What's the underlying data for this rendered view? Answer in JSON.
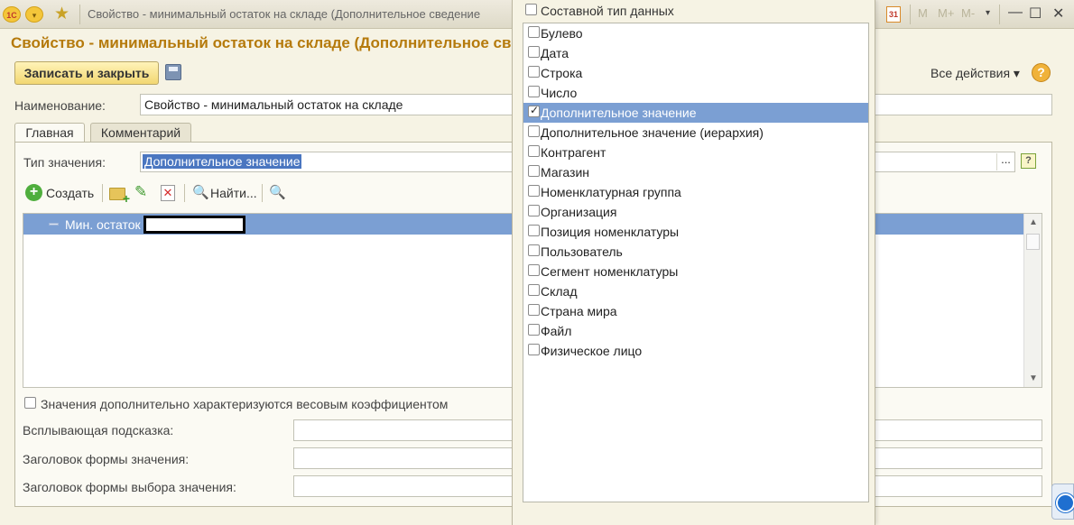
{
  "window": {
    "title": "Свойство - минимальный остаток на складе (Дополнительное сведение",
    "logo_text": "1С",
    "down_glyph": "▾",
    "star_glyph": "★",
    "calendar_text": "31",
    "memory_buttons": [
      "M",
      "M+",
      "M-"
    ],
    "minimize_glyph": "—",
    "maximize_glyph": "☐",
    "close_glyph": "✕"
  },
  "form": {
    "title": "Свойство - минимальный остаток на складе (Дополнительное све",
    "save_close_label": "Записать и закрыть",
    "all_actions_label": "Все действия ▾",
    "help_glyph": "?",
    "name_label": "Наименование:",
    "name_value": "Свойство - минимальный остаток на складе"
  },
  "tabs": [
    {
      "label": "Главная",
      "active": true
    },
    {
      "label": "Комментарий",
      "active": false
    }
  ],
  "main_tab": {
    "value_type_label": "Тип значения:",
    "value_type_value": "Дополнительное значение",
    "select_button_label": "...",
    "hint_glyph": "?",
    "toolbar": {
      "create_glyph": "+",
      "create_label": "Создать",
      "pencil_glyph": "✎",
      "delete_glyph": "✕",
      "find_glyph": "🔍",
      "find_label": "Найти...",
      "find_extra_glyph": "🔍"
    },
    "values_list": [
      {
        "name": "Мин. остаток",
        "selected": true
      }
    ],
    "scroll_up_glyph": "▲",
    "scroll_down_glyph": "▼",
    "weight_checkbox_label": "Значения дополнительно характеризуются весовым коэффициентом",
    "weight_checked": false,
    "tooltip_label": "Всплывающая подсказка:",
    "value_form_title_label": "Заголовок формы значения:",
    "choice_form_title_label": "Заголовок формы выбора значения:"
  },
  "type_popup": {
    "composite_label": "Составной тип данных",
    "composite_checked": false,
    "items": [
      {
        "label": "Булево",
        "checked": false,
        "selected": false
      },
      {
        "label": "Дата",
        "checked": false,
        "selected": false
      },
      {
        "label": "Строка",
        "checked": false,
        "selected": false
      },
      {
        "label": "Число",
        "checked": false,
        "selected": false
      },
      {
        "label": "Дополнительное значение",
        "checked": true,
        "selected": true
      },
      {
        "label": "Дополнительное значение (иерархия)",
        "checked": false,
        "selected": false
      },
      {
        "label": "Контрагент",
        "checked": false,
        "selected": false
      },
      {
        "label": "Магазин",
        "checked": false,
        "selected": false
      },
      {
        "label": "Номенклатурная группа",
        "checked": false,
        "selected": false
      },
      {
        "label": "Организация",
        "checked": false,
        "selected": false
      },
      {
        "label": "Позиция номенклатуры",
        "checked": false,
        "selected": false
      },
      {
        "label": "Пользователь",
        "checked": false,
        "selected": false
      },
      {
        "label": "Сегмент номенклатуры",
        "checked": false,
        "selected": false
      },
      {
        "label": "Склад",
        "checked": false,
        "selected": false
      },
      {
        "label": "Страна мира",
        "checked": false,
        "selected": false
      },
      {
        "label": "Файл",
        "checked": false,
        "selected": false
      },
      {
        "label": "Физическое лицо",
        "checked": false,
        "selected": false
      }
    ]
  }
}
